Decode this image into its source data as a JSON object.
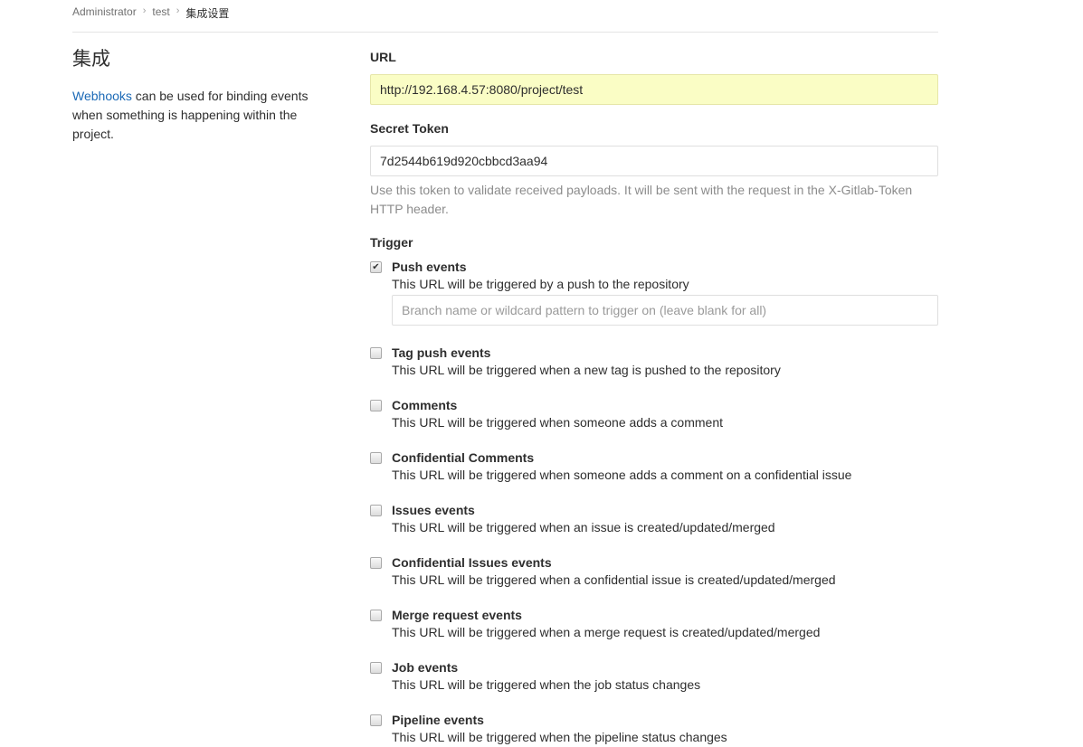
{
  "breadcrumb": {
    "items": [
      "Administrator",
      "test",
      "集成设置"
    ]
  },
  "section": {
    "title": "集成",
    "link_text": "Webhooks",
    "description": " can be used for binding events when something is happening within the project."
  },
  "form": {
    "url_label": "URL",
    "url_value": "http://192.168.4.57:8080/project/test",
    "token_label": "Secret Token",
    "token_value": "7d2544b619d920cbbcd3aa94",
    "token_help": "Use this token to validate received payloads. It will be sent with the request in the X-Gitlab-Token HTTP header.",
    "trigger_label": "Trigger",
    "branch_placeholder": "Branch name or wildcard pattern to trigger on (leave blank for all)"
  },
  "triggers": [
    {
      "title": "Push events",
      "desc": "This URL will be triggered by a push to the repository",
      "checked": true
    },
    {
      "title": "Tag push events",
      "desc": "This URL will be triggered when a new tag is pushed to the repository",
      "checked": false
    },
    {
      "title": "Comments",
      "desc": "This URL will be triggered when someone adds a comment",
      "checked": false
    },
    {
      "title": "Confidential Comments",
      "desc": "This URL will be triggered when someone adds a comment on a confidential issue",
      "checked": false
    },
    {
      "title": "Issues events",
      "desc": "This URL will be triggered when an issue is created/updated/merged",
      "checked": false
    },
    {
      "title": "Confidential Issues events",
      "desc": "This URL will be triggered when a confidential issue is created/updated/merged",
      "checked": false
    },
    {
      "title": "Merge request events",
      "desc": "This URL will be triggered when a merge request is created/updated/merged",
      "checked": false
    },
    {
      "title": "Job events",
      "desc": "This URL will be triggered when the job status changes",
      "checked": false
    },
    {
      "title": "Pipeline events",
      "desc": "This URL will be triggered when the pipeline status changes",
      "checked": false
    }
  ],
  "colors": {
    "link": "#1b69b6",
    "url_field_bg": "#fafdc5"
  }
}
